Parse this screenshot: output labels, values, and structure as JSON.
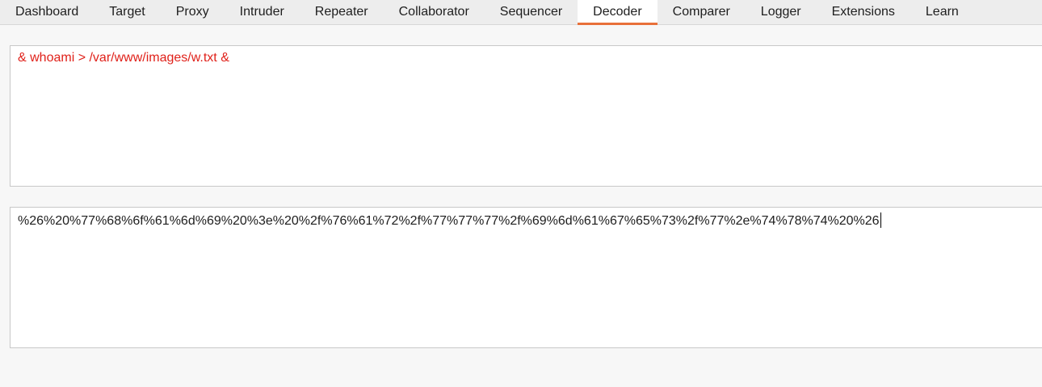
{
  "tabs": [
    {
      "label": "Dashboard",
      "name": "tab-dashboard"
    },
    {
      "label": "Target",
      "name": "tab-target"
    },
    {
      "label": "Proxy",
      "name": "tab-proxy"
    },
    {
      "label": "Intruder",
      "name": "tab-intruder"
    },
    {
      "label": "Repeater",
      "name": "tab-repeater"
    },
    {
      "label": "Collaborator",
      "name": "tab-collaborator"
    },
    {
      "label": "Sequencer",
      "name": "tab-sequencer"
    },
    {
      "label": "Decoder",
      "name": "tab-decoder",
      "active": true
    },
    {
      "label": "Comparer",
      "name": "tab-comparer"
    },
    {
      "label": "Logger",
      "name": "tab-logger"
    },
    {
      "label": "Extensions",
      "name": "tab-extensions"
    },
    {
      "label": "Learn",
      "name": "tab-learn"
    }
  ],
  "colors": {
    "accent": "#e8703a",
    "input_text": "#e0211a"
  },
  "decoder": {
    "input_text": "& whoami > /var/www/images/w.txt &",
    "output_text": "%26%20%77%68%6f%61%6d%69%20%3e%20%2f%76%61%72%2f%77%77%77%2f%69%6d%61%67%65%73%2f%77%2e%74%78%74%20%26"
  }
}
